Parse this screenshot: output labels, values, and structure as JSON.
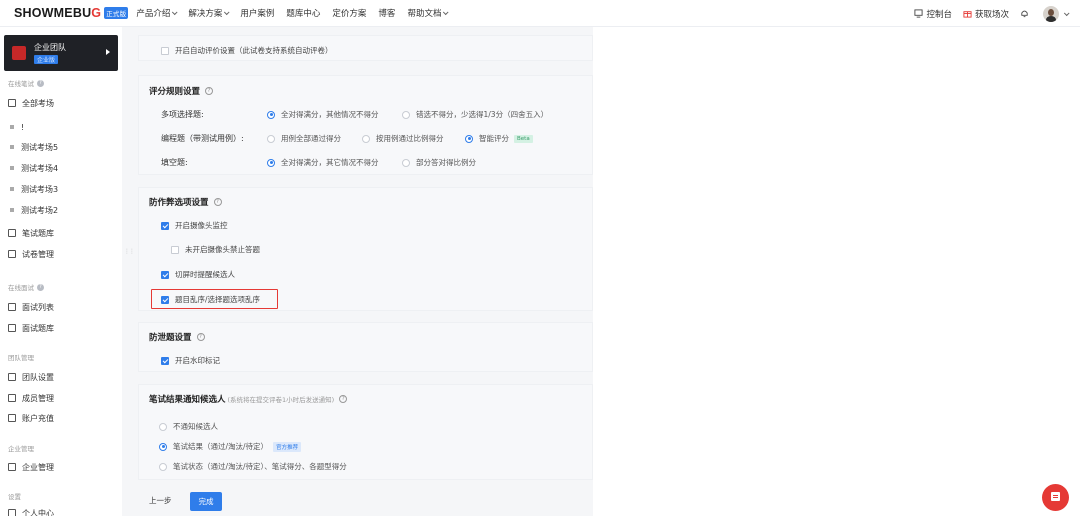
{
  "header": {
    "logo_text": "SHOWMEBU",
    "logo_text_accent": "G",
    "logo_tag": "正式版",
    "nav": [
      {
        "label": "产品介绍",
        "has_caret": true
      },
      {
        "label": "解决方案",
        "has_caret": true
      },
      {
        "label": "用户案例",
        "has_caret": false
      },
      {
        "label": "题库中心",
        "has_caret": false
      },
      {
        "label": "定价方案",
        "has_caret": false
      },
      {
        "label": "博客",
        "has_caret": false
      },
      {
        "label": "帮助文档",
        "has_caret": true
      }
    ],
    "console_label": "控制台",
    "get_sessions_label": "获取场次"
  },
  "sidebar": {
    "team_name": "企业团队",
    "team_badge": "企业版",
    "section_written": "在线笔试",
    "all_exams": "全部考场",
    "exam_items": [
      "!",
      "测试考场5",
      "测试考场4",
      "测试考场3",
      "测试考场2"
    ],
    "question_bank": "笔试题库",
    "paper_mgmt": "试卷管理",
    "section_interview": "在线面试",
    "interview_list": "面试列表",
    "interview_bank": "面试题库",
    "section_team": "团队管理",
    "team_settings": "团队设置",
    "member_mgmt": "成员管理",
    "account_recharge": "账户充值",
    "section_enterprise": "企业管理",
    "enterprise_mgmt": "企业管理",
    "section_settings": "设置",
    "personal_center": "个人中心"
  },
  "settings": {
    "auto_eval_label": "开启自动评价设置（此试卷支持系统自动评卷）",
    "scoring": {
      "title": "评分规则设置",
      "multi_choice_label": "多项选择题:",
      "multi_choice_opt1": "全对得满分，其他情况不得分",
      "multi_choice_opt2": "错选不得分，少选得1/3分（四舍五入）",
      "coding_label": "编程题（带测试用例）:",
      "coding_opt1": "用例全部通过得分",
      "coding_opt2": "按用例通过比例得分",
      "coding_opt3": "智能评分",
      "coding_opt3_tag": "Beta",
      "fill_label": "填空题:",
      "fill_opt1": "全对得满分，其它情况不得分",
      "fill_opt2": "部分答对得比例分"
    },
    "anti_cheat": {
      "title": "防作弊选项设置",
      "camera": "开启摄像头监控",
      "camera_block": "未开启摄像头禁止答题",
      "switch_alert": "切屏时提醒候选人",
      "shuffle": "题目乱序/选择题选项乱序"
    },
    "anti_leak": {
      "title": "防泄题设置",
      "watermark": "开启水印标记"
    },
    "notify": {
      "title": "笔试结果通知候选人",
      "subtitle": "(系统将在提交评卷1小时后发送通知)",
      "opt1": "不通知候选人",
      "opt2": "笔试结果（通过/淘汰/待定）",
      "opt2_tag": "官方推荐",
      "opt3": "笔试状态（通过/淘汰/待定）、笔试得分、各题型得分"
    }
  },
  "footer": {
    "prev_label": "上一步",
    "done_label": "完成"
  },
  "colors": {
    "accent": "#2f7dea",
    "brand_red": "#e53935",
    "highlight_border": "#e53935"
  }
}
